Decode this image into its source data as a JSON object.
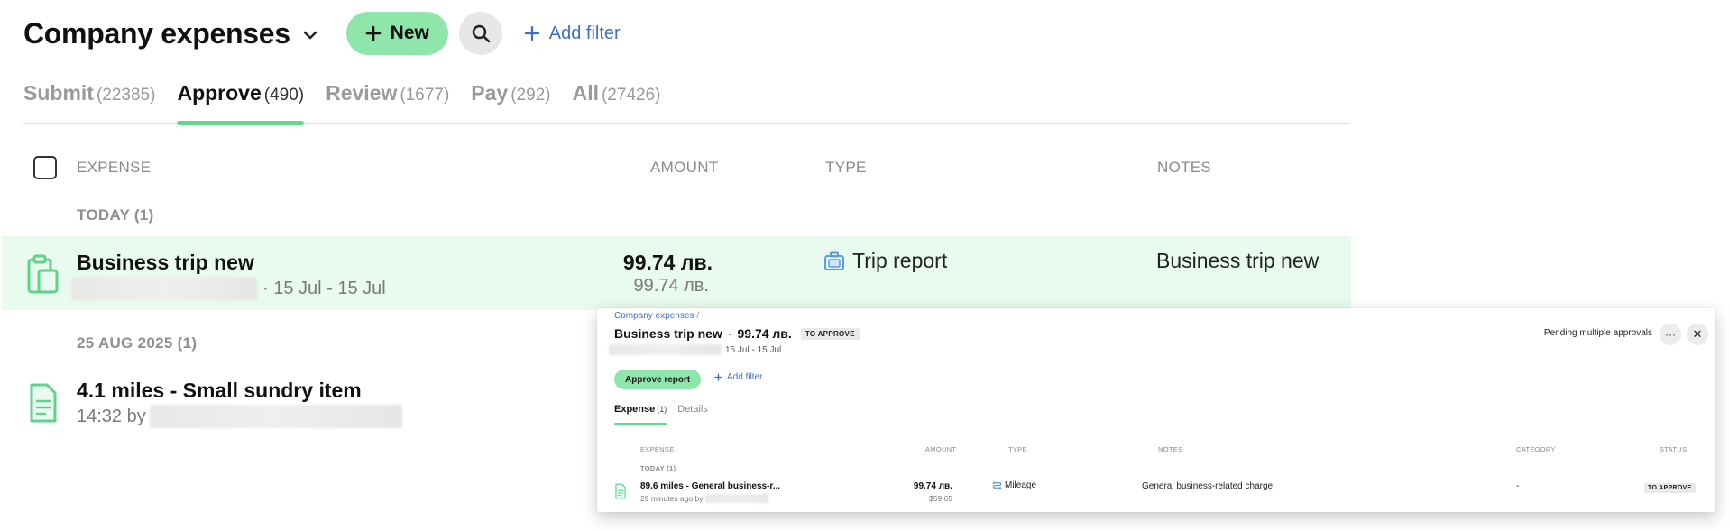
{
  "header": {
    "title": "Company expenses",
    "new_label": "New",
    "add_filter_label": "Add filter"
  },
  "tabs": [
    {
      "label": "Submit",
      "count": "(22385)",
      "active": false
    },
    {
      "label": "Approve",
      "count": "(490)",
      "active": true
    },
    {
      "label": "Review",
      "count": "(1677)",
      "active": false
    },
    {
      "label": "Pay",
      "count": "(292)",
      "active": false
    },
    {
      "label": "All",
      "count": "(27426)",
      "active": false
    }
  ],
  "table": {
    "columns": {
      "expense": "EXPENSE",
      "amount": "AMOUNT",
      "type": "TYPE",
      "notes": "NOTES"
    },
    "groups": [
      {
        "label": "TODAY (1)",
        "rows": [
          {
            "name": "Business trip new",
            "sub": "· 15 Jul - 15 Jul",
            "amount": "99.74 лв.",
            "amount_secondary": "99.74 лв.",
            "type": "Trip report",
            "notes": "Business trip new"
          }
        ]
      },
      {
        "label": "25 AUG 2025 (1)",
        "rows": [
          {
            "name": "4.1 miles - Small sundry item",
            "sub": "14:32 by",
            "amount": "",
            "amount_secondary": "",
            "type": "",
            "notes": ""
          }
        ]
      }
    ]
  },
  "panel": {
    "breadcrumb": "Company expenses",
    "breadcrumb_sep": "/",
    "title": "Business trip new",
    "separator": "·",
    "amount": "99.74 лв.",
    "status_badge": "TO APPROVE",
    "dates": "15 Jul - 15 Jul",
    "pending": "Pending multiple approvals",
    "more": "···",
    "close": "✕",
    "approve_label": "Approve report",
    "add_filter_label": "Add filter",
    "tabs": [
      {
        "label": "Expense",
        "count": "(1)",
        "active": true
      },
      {
        "label": "Details",
        "count": "",
        "active": false
      }
    ],
    "columns": {
      "expense": "EXPENSE",
      "amount": "AMOUNT",
      "type": "TYPE",
      "notes": "NOTES",
      "category": "CATEGORY",
      "status": "STATUS"
    },
    "group_label": "TODAY (1)",
    "row": {
      "name": "89.6 miles - General business-r...",
      "sub": "29 minutes ago by",
      "amount": "99.74 лв.",
      "amount_secondary": "$59.65",
      "type": "Mileage",
      "notes": "General business-related charge",
      "category": "-",
      "status": "TO APPROVE"
    }
  },
  "colors": {
    "accent_green": "#8ee6aa",
    "tab_underline": "#62d88b",
    "link_blue": "#3f6fc4",
    "highlight_row": "#e9faee"
  },
  "icons": {
    "title_dropdown": "chevron-down-icon",
    "new": "plus-icon",
    "search": "search-icon",
    "add_filter": "plus-icon",
    "trip_report": "clipboard-icon",
    "expense": "receipt-icon",
    "trip_type": "briefcase-icon",
    "mileage": "route-icon"
  }
}
